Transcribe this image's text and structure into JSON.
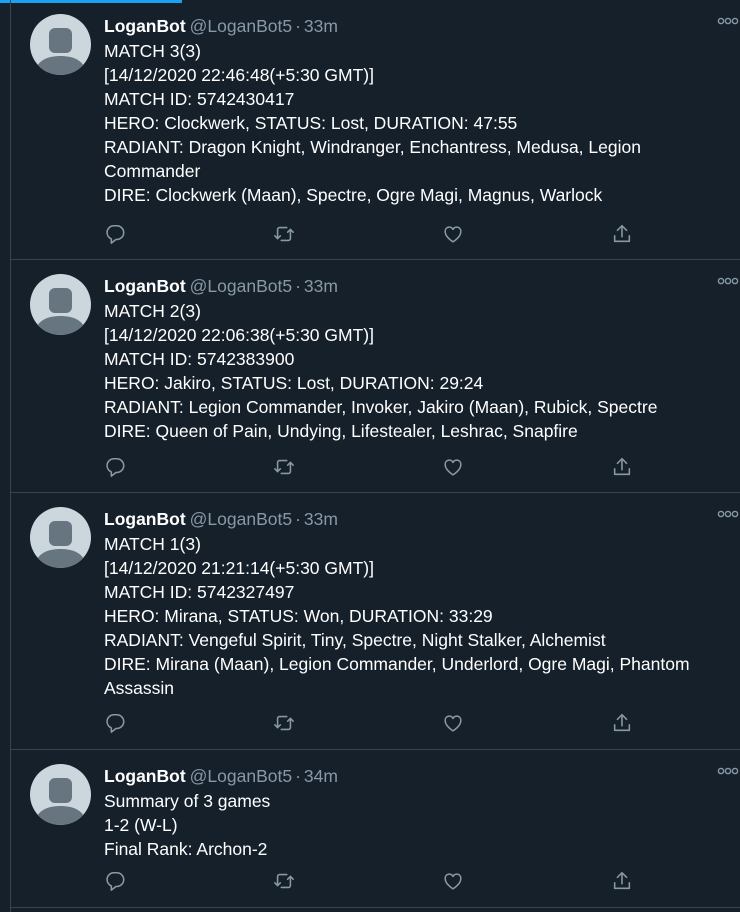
{
  "colors": {
    "background": "#15202b",
    "accent": "#1da1f2",
    "muted": "#8899a6",
    "divider": "#38444d"
  },
  "icons": {
    "reply": "reply-icon",
    "retweet": "retweet-icon",
    "like": "like-icon",
    "share": "share-icon",
    "more": "more-icon"
  },
  "tweets": [
    {
      "name": "LoganBot",
      "handle": "@LoganBot5",
      "separator": "·",
      "time": "33m",
      "lines": [
        "MATCH 3(3)",
        "[14/12/2020 22:46:48(+5:30 GMT)]",
        "MATCH ID: 5742430417",
        "HERO: Clockwerk, STATUS: Lost, DURATION: 47:55",
        "RADIANT: Dragon Knight, Windranger, Enchantress, Medusa, Legion Commander",
        "DIRE: Clockwerk (Maan), Spectre, Ogre Magi, Magnus, Warlock"
      ]
    },
    {
      "name": "LoganBot",
      "handle": "@LoganBot5",
      "separator": "·",
      "time": "33m",
      "lines": [
        "MATCH 2(3)",
        "[14/12/2020 22:06:38(+5:30 GMT)]",
        "MATCH ID: 5742383900",
        "HERO: Jakiro, STATUS: Lost, DURATION: 29:24",
        "RADIANT: Legion Commander, Invoker, Jakiro (Maan), Rubick, Spectre",
        "DIRE: Queen of Pain, Undying, Lifestealer, Leshrac, Snapfire"
      ]
    },
    {
      "name": "LoganBot",
      "handle": "@LoganBot5",
      "separator": "·",
      "time": "33m",
      "lines": [
        "MATCH 1(3)",
        "[14/12/2020 21:21:14(+5:30 GMT)]",
        "MATCH ID: 5742327497",
        "HERO: Mirana, STATUS: Won, DURATION: 33:29",
        "RADIANT: Vengeful Spirit, Tiny, Spectre, Night Stalker, Alchemist",
        "DIRE: Mirana (Maan), Legion Commander, Underlord, Ogre Magi, Phantom Assassin"
      ]
    },
    {
      "name": "LoganBot",
      "handle": "@LoganBot5",
      "separator": "·",
      "time": "34m",
      "lines": [
        "Summary of 3 games",
        "1-2 (W-L)",
        "Final Rank: Archon-2"
      ]
    }
  ]
}
